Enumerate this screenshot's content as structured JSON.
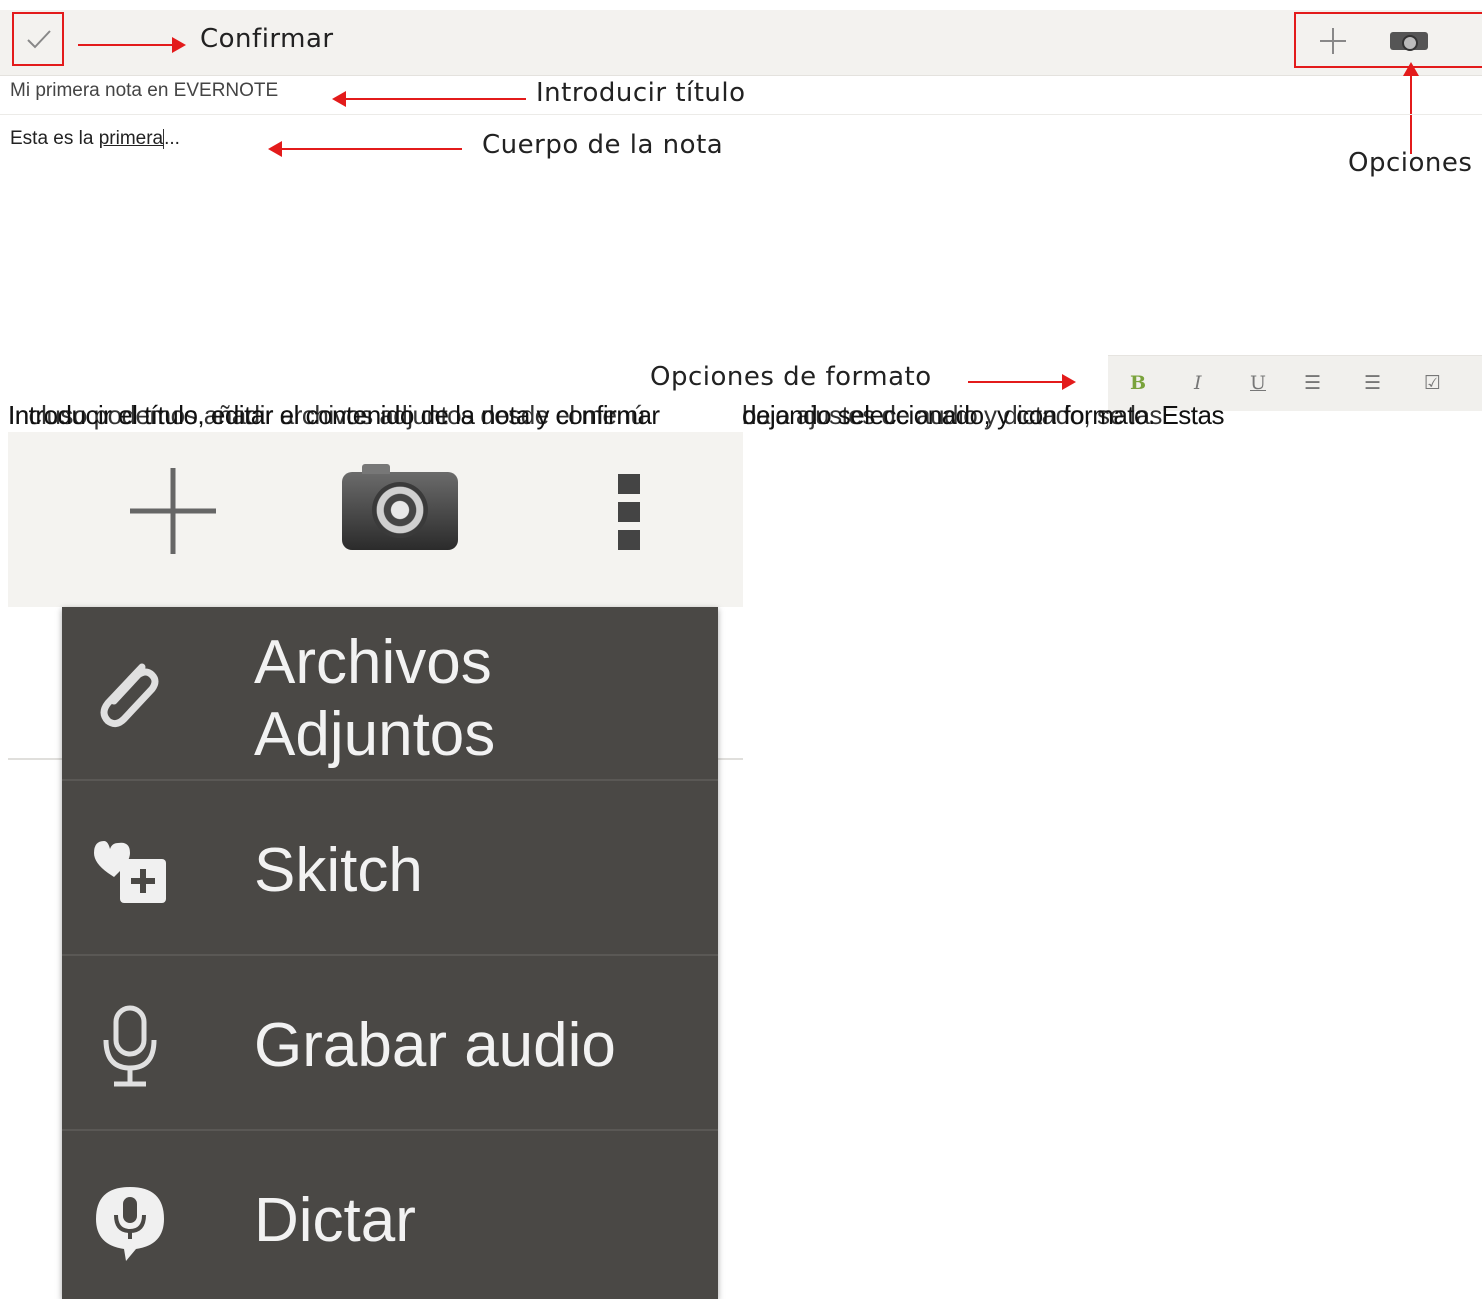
{
  "annotations": {
    "confirm": "Confirmar",
    "title": "Introducir título",
    "body": "Cuerpo de la nota",
    "options": "Opciones",
    "format": "Opciones de formato"
  },
  "note": {
    "title": "Mi primera nota en EVERNOTE",
    "body_prefix": "Esta es la ",
    "body_underlined": "primera",
    "body_suffix": "..."
  },
  "format_bar": {
    "bold": "B",
    "italic": "I",
    "underline": "U",
    "ordered_list": "☰",
    "bullet_list": "☰",
    "checkbox": "☑"
  },
  "caption": {
    "line_1a": "Introducir el título, editar el contenido de la nota y confirmar",
    "line_1b": "Incluso podemos añadir archivos adjuntos desde el menú",
    "line_2a": "dejando seleccionado, y con formato. Estas",
    "line_2b": "bajo ajustes de audio y dictado, se las"
  },
  "menu": {
    "items": [
      {
        "label": "Archivos Adjuntos",
        "icon": "paperclip-icon"
      },
      {
        "label": "Skitch",
        "icon": "skitch-icon"
      },
      {
        "label": "Grabar audio",
        "icon": "microphone-icon"
      },
      {
        "label": "Dictar",
        "icon": "dictate-icon"
      }
    ]
  },
  "colors": {
    "annotation_red": "#e31b1b",
    "menu_bg": "#4a4845",
    "toolbar_bg": "#f3f2ef",
    "bold_green": "#7aa33c"
  }
}
